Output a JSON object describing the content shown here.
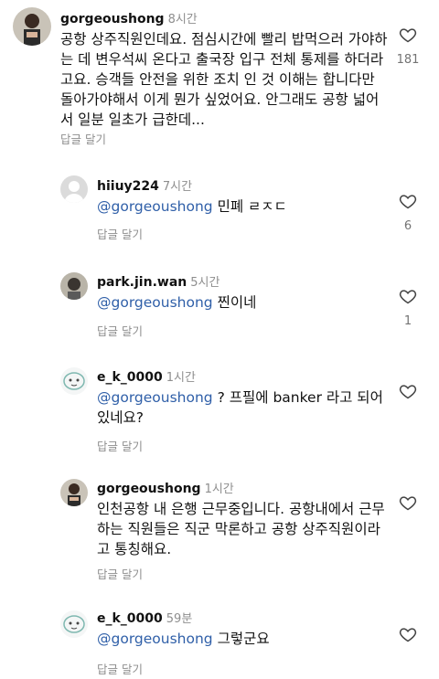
{
  "reply_label": "답글 달기",
  "comments": [
    {
      "username": "gorgeoushong",
      "time": "8시간",
      "mention": "",
      "text": "공항 상주직원인데요. 점심시간에 빨리 밥먹으러 가야하는 데 변우석씨 온다고 출국장 입구 전체 통제를 하더라고요. 승객들 안전을 위한 조치 인 것 이해는 합니다만 돌아가야해서 이게 뭔가 싶었어요. 안그래도 공항 넓어서 일분 일초가 급한데...",
      "likes": "181",
      "avatar": "profile-photo"
    },
    {
      "username": "hiiuy224",
      "time": "7시간",
      "mention": "@gorgeoushong",
      "text": " 민폐 ㄹㅈㄷ",
      "likes": "6",
      "avatar": "default-avatar"
    },
    {
      "username": "park.jin.wan",
      "time": "5시간",
      "mention": "@gorgeoushong",
      "text": " 찐이네",
      "likes": "1",
      "avatar": "profile-photo"
    },
    {
      "username": "e_k_0000",
      "time": "1시간",
      "mention": "@gorgeoushong",
      "text": " ? 프필에 banker 라고 되어있네요?",
      "likes": "",
      "avatar": "cartoon-avatar"
    },
    {
      "username": "gorgeoushong",
      "time": "1시간",
      "mention": "",
      "text": "인천공항 내 은행 근무중입니다. 공항내에서 근무하는 직원들은 직군 막론하고 공항 상주직원이라고 통칭해요.",
      "likes": "",
      "avatar": "profile-photo"
    },
    {
      "username": "e_k_0000",
      "time": "59분",
      "mention": "@gorgeoushong",
      "text": " 그렇군요",
      "likes": "",
      "avatar": "cartoon-avatar"
    }
  ]
}
